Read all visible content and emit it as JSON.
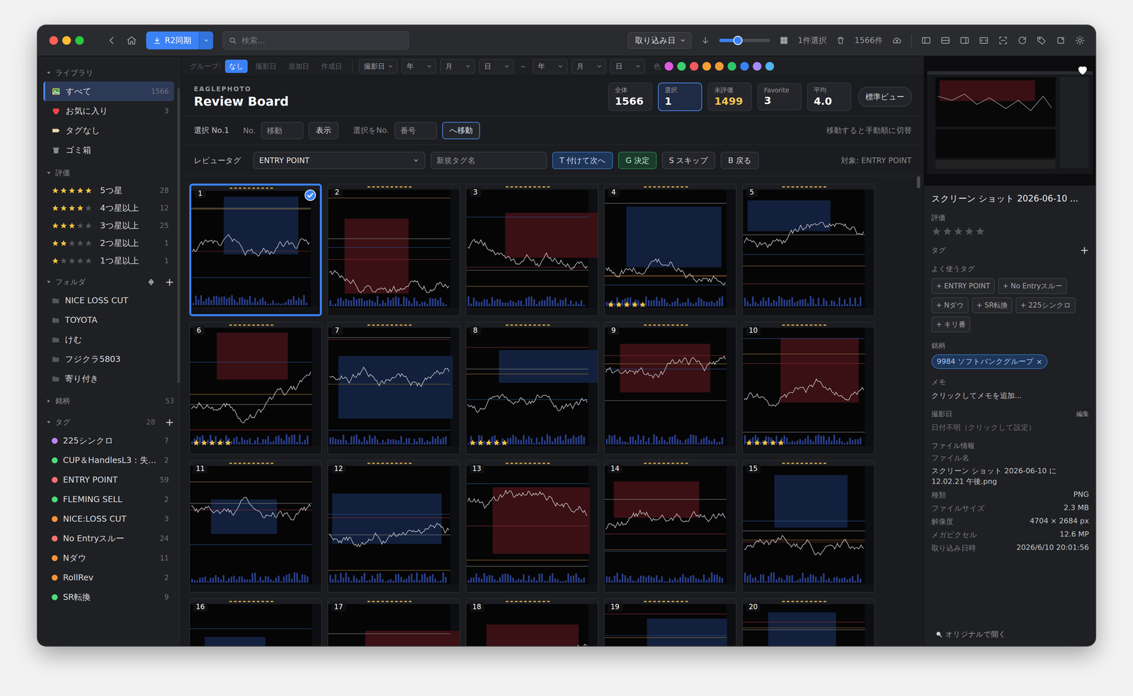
{
  "toolbar": {
    "sync_button": "R2同期",
    "search_placeholder": "検索...",
    "sort": "取り込み日",
    "size_slider": {
      "level": 0.37
    },
    "selection_count": "1件選択",
    "total_count": "1566件"
  },
  "filter_bar": {
    "group_label": "グループ:",
    "group_options": [
      {
        "label": "なし",
        "selected": true
      },
      {
        "label": "撮影日",
        "selected": false
      },
      {
        "label": "追加日",
        "selected": false
      },
      {
        "label": "作成日",
        "selected": false
      }
    ],
    "date_field": "撮影日",
    "from": [
      "年",
      "月",
      "日"
    ],
    "range_separator": "～",
    "to": [
      "年",
      "月",
      "日"
    ],
    "color_label": "色",
    "colors": [
      {
        "color": "#e05ce0"
      },
      {
        "color": "#3ecf6e"
      },
      {
        "color": "#ef5b5b"
      },
      {
        "color": "#f5a030"
      },
      {
        "color": "#f39a3a"
      },
      {
        "color": "#2fc46a"
      },
      {
        "color": "#3b82f6"
      },
      {
        "color": "#a78bfa"
      },
      {
        "color": "#4fb3f0"
      }
    ]
  },
  "sidebar": {
    "library": {
      "title": "ライブラリ",
      "expanded": true,
      "items": [
        {
          "label": "すべて",
          "count": "1566",
          "selected": true,
          "kind": "all"
        },
        {
          "label": "お気に入り",
          "count": "3",
          "selected": false,
          "kind": "favorite"
        },
        {
          "label": "タグなし",
          "selected": false,
          "kind": "untagged"
        },
        {
          "label": "ゴミ箱",
          "selected": false,
          "kind": "trash"
        }
      ]
    },
    "ratings": {
      "title": "評価",
      "expanded": true,
      "items": [
        {
          "label": "5つ星",
          "count": "28",
          "stars": 5,
          "selected": false
        },
        {
          "label": "4つ星以上",
          "count": "12",
          "stars": 4,
          "selected": false
        },
        {
          "label": "3つ星以上",
          "count": "25",
          "stars": 3,
          "selected": false
        },
        {
          "label": "2つ星以上",
          "count": "1",
          "stars": 2,
          "selected": false
        },
        {
          "label": "1つ星以上",
          "count": "1",
          "stars": 1,
          "selected": false
        }
      ]
    },
    "folders": {
      "title": "フォルダ",
      "expanded": true,
      "add": "+",
      "items": [
        {
          "label": "NICE LOSS CUT",
          "selected": false
        },
        {
          "label": "TOYOTA",
          "selected": false
        },
        {
          "label": "けむ",
          "selected": false
        },
        {
          "label": "フジクラ5803",
          "selected": false
        },
        {
          "label": "寄り付き",
          "selected": false
        }
      ]
    },
    "tickers": {
      "title": "銘柄",
      "expanded": false,
      "count": "53"
    },
    "tags": {
      "title": "タグ",
      "expanded": true,
      "count": "28",
      "add": "+",
      "items": [
        {
          "label": "225シンクロ",
          "count": "7",
          "color": "#c084fc",
          "selected": false
        },
        {
          "label": "CUP＆HandlesL3：失…",
          "count": "2",
          "color": "#4ade80",
          "selected": false
        },
        {
          "label": "ENTRY POINT",
          "count": "59",
          "color": "#f87171",
          "selected": false
        },
        {
          "label": "FLEMING SELL",
          "count": "2",
          "color": "#4ade80",
          "selected": false
        },
        {
          "label": "NICE:LOSS CUT",
          "count": "3",
          "color": "#fb923c",
          "selected": false
        },
        {
          "label": "No Entryスルー",
          "count": "24",
          "color": "#f87171",
          "selected": false
        },
        {
          "label": "Nダウ",
          "count": "11",
          "color": "#fb923c",
          "selected": false
        },
        {
          "label": "RollRev",
          "count": "2",
          "color": "#fb923c",
          "selected": false
        },
        {
          "label": "SR転換",
          "count": "9",
          "color": "#4ade80",
          "selected": false
        }
      ]
    }
  },
  "header": {
    "brand": "EAGLEPHOTO",
    "title": "Review Board",
    "stats": [
      {
        "label": "全体",
        "value": "1566",
        "selected": false,
        "color": "#ffffff"
      },
      {
        "label": "選択",
        "value": "1",
        "selected": true,
        "color": "#ffffff"
      },
      {
        "label": "未評価",
        "value": "1499",
        "selected": false,
        "color": "#f5c451"
      },
      {
        "label": "Favorite",
        "value": "3",
        "selected": false,
        "color": "#ffffff"
      },
      {
        "label": "平均",
        "value": "4.0",
        "selected": false,
        "color": "#ffffff"
      }
    ],
    "view_button": "標準ビュー"
  },
  "nav": {
    "label": "選択 No.1",
    "no_label": "No.",
    "no_placeholder": "移動",
    "show_button": "表示",
    "move_label": "選択をNo.",
    "move_placeholder": "番号",
    "move_button": "へ移動",
    "hint": "移動すると手動順に切替"
  },
  "review": {
    "label": "レビュータグ",
    "tag_select": "ENTRY POINT",
    "new_tag_placeholder": "新規タグ名",
    "buttons": [
      {
        "label": "T 付けて次へ",
        "kind": "primary"
      },
      {
        "label": "G 決定",
        "kind": "success"
      },
      {
        "label": "S スキップ",
        "kind": "plain"
      },
      {
        "label": "B 戻る",
        "kind": "plain"
      }
    ],
    "target": "対象: ENTRY POINT"
  },
  "grid": {
    "items": [
      {
        "number": "1",
        "selected": true,
        "stars": 0
      },
      {
        "number": "2",
        "selected": false,
        "stars": 0
      },
      {
        "number": "3",
        "selected": false,
        "stars": 0
      },
      {
        "number": "4",
        "selected": false,
        "stars": 5
      },
      {
        "number": "5",
        "selected": false,
        "stars": 0
      },
      {
        "number": "6",
        "selected": false,
        "stars": 5
      },
      {
        "number": "7",
        "selected": false,
        "stars": 0
      },
      {
        "number": "8",
        "selected": false,
        "stars": 5
      },
      {
        "number": "9",
        "selected": false,
        "stars": 0
      },
      {
        "number": "10",
        "selected": false,
        "stars": 5
      },
      {
        "number": "11",
        "selected": false,
        "stars": 0
      },
      {
        "number": "12",
        "selected": false,
        "stars": 0
      },
      {
        "number": "13",
        "selected": false,
        "stars": 0
      },
      {
        "number": "14",
        "selected": false,
        "stars": 0
      },
      {
        "number": "15",
        "selected": false,
        "stars": 0
      },
      {
        "number": "16",
        "selected": false,
        "stars": 0
      },
      {
        "number": "17",
        "selected": false,
        "stars": 0
      },
      {
        "number": "18",
        "selected": false,
        "stars": 0
      },
      {
        "number": "19",
        "selected": false,
        "stars": 0
      },
      {
        "number": "20",
        "selected": false,
        "stars": 0
      }
    ]
  },
  "details": {
    "favorite": true,
    "title": "スクリーン ショット 2026-06-10 ...",
    "rating_label": "評価",
    "stars": 0,
    "tags_label": "タグ",
    "tags_add": "+",
    "frequent_label": "よく使うタグ",
    "frequent_tags": [
      "+ ENTRY POINT",
      "+ No Entryスルー",
      "+ Nダウ",
      "+ SR転換",
      "+ 225シンクロ",
      "+ キリ番"
    ],
    "ticker_label": "銘柄",
    "tickers": [
      {
        "label": "9984 ソフトバンクグループ",
        "remove": "×"
      }
    ],
    "memo_label": "メモ",
    "memo_placeholder": "クリックしてメモを追加...",
    "date_label": "撮影日",
    "date_edit": "編集",
    "date_value": "日付不明（クリックして設定）",
    "file_info_label": "ファイル情報",
    "file_name_label": "ファイル名",
    "file_name": "スクリーン ショット 2026-06-10 に 12.02.21 午後.png",
    "info_rows": [
      {
        "key": "種類",
        "value": "PNG"
      },
      {
        "key": "ファイルサイズ",
        "value": "2.3 MB"
      },
      {
        "key": "解像度",
        "value": "4704 × 2684 px"
      },
      {
        "key": "メガピクセル",
        "value": "12.6 MP"
      },
      {
        "key": "取り込み日時",
        "value": "2026/6/10 20:01:56"
      }
    ],
    "open_original": "オリジナルで開く"
  }
}
